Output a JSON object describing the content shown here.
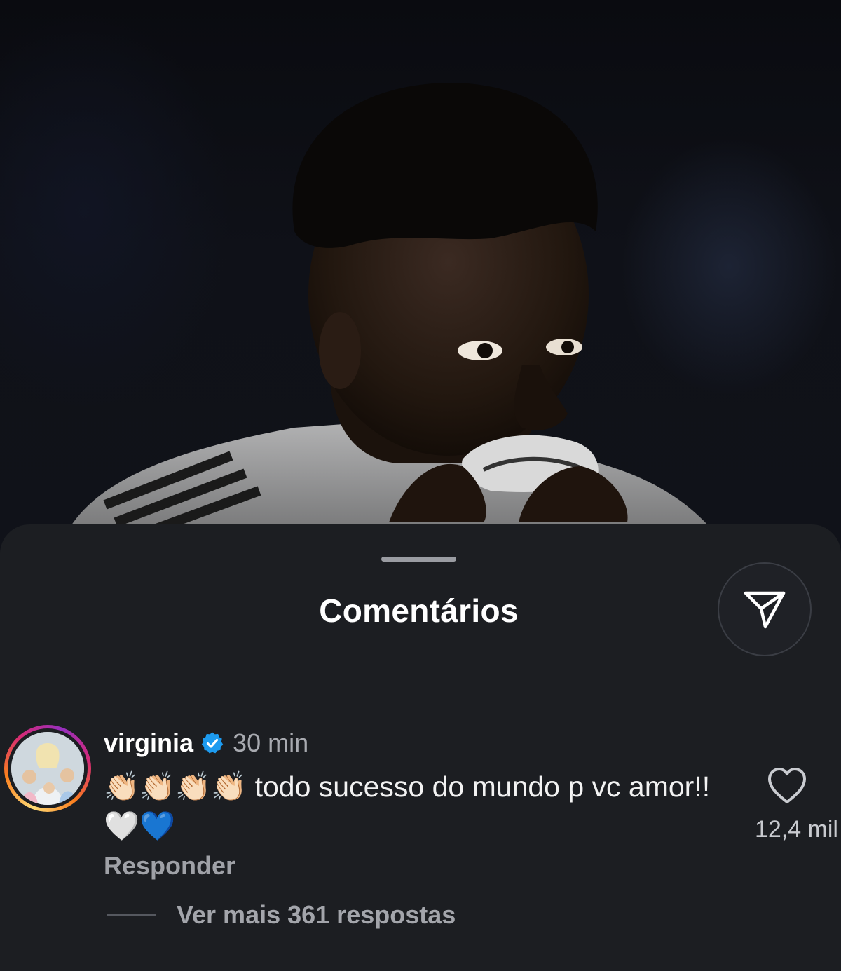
{
  "sheet": {
    "title": "Comentários"
  },
  "comment": {
    "username": "virginia",
    "verified": true,
    "time": "30 min",
    "text": "👏🏻👏🏻👏🏻👏🏻 todo sucesso do mundo p vc amor!! 🤍💙",
    "reply_label": "Responder",
    "like_count": "12,4 mil",
    "view_replies_label": "Ver mais 361 respostas"
  },
  "colors": {
    "sheet_background": "#1c1e22",
    "verified_badge": "#1d9bf0",
    "story_ring": "#d62976"
  },
  "icons": {
    "share": "paper-plane-icon",
    "like": "heart-outline-icon",
    "verified": "verified-badge-icon"
  }
}
